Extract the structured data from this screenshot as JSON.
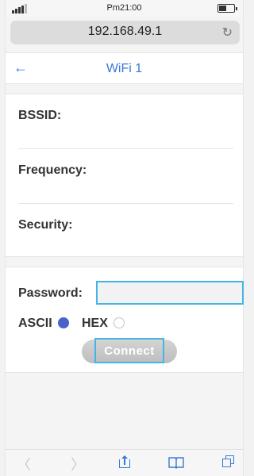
{
  "status_bar": {
    "time": "Pm21:00",
    "signal_icon": "signal-bars-icon",
    "battery_icon": "battery-icon"
  },
  "browser": {
    "url": "192.168.49.1",
    "reload_icon": "reload-icon"
  },
  "header": {
    "back_icon": "back-arrow-icon",
    "back_symbol": "←",
    "title": "WiFi 1"
  },
  "info": {
    "bssid_label": "BSSID:",
    "frequency_label": "Frequency:",
    "security_label": "Security:"
  },
  "form": {
    "password_label": "Password:",
    "password_value": "",
    "encoding_options": [
      "ASCII",
      "HEX"
    ],
    "selected_encoding": "ASCII",
    "connect_label": "Connect"
  },
  "toolbar": {
    "back_icon": "browser-back-icon",
    "forward_icon": "browser-forward-icon",
    "share_icon": "share-icon",
    "bookmarks_icon": "bookmarks-icon",
    "tabs_icon": "tabs-icon"
  },
  "colors": {
    "accent": "#3a78d6",
    "focus_border": "#45b4e6",
    "radio_checked": "#4a63c8"
  }
}
